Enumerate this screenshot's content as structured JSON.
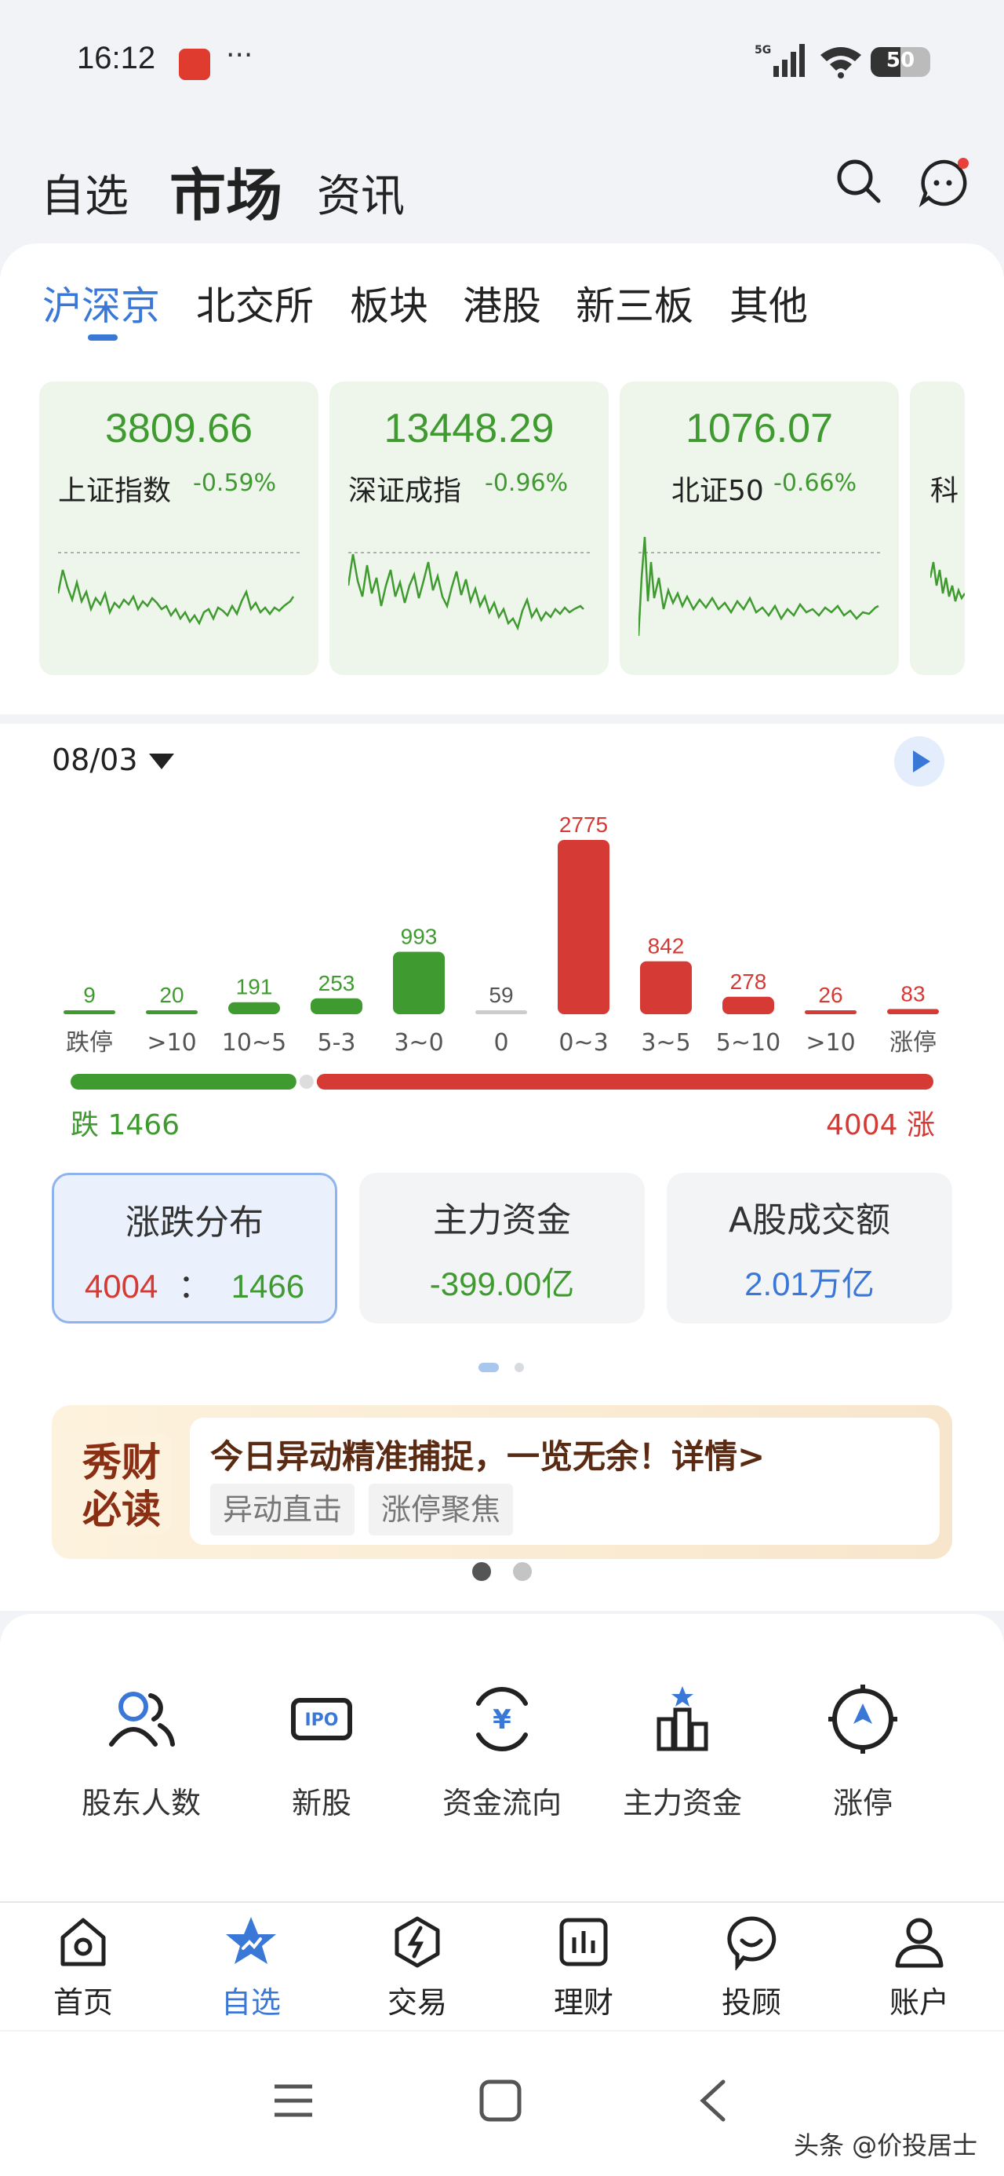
{
  "status_bar": {
    "time": "16:12",
    "dots": "···",
    "network": "5G",
    "battery": "50"
  },
  "top_nav": {
    "tabs": [
      "自选",
      "市场",
      "资讯"
    ],
    "active": "市场"
  },
  "sub_tabs": [
    "沪深京",
    "北交所",
    "板块",
    "港股",
    "新三板",
    "其他"
  ],
  "indices": [
    {
      "value": "3809.66",
      "name": "上证指数",
      "change": "-0.59%"
    },
    {
      "value": "13448.29",
      "name": "深证成指",
      "change": "-0.96%"
    },
    {
      "value": "1076.07",
      "name": "北证50",
      "change": "-0.66%"
    },
    {
      "value": "",
      "name": "科",
      "change": ""
    }
  ],
  "distribution": {
    "date": "08/03",
    "total_down_label": "跌 1466",
    "total_up_label": "4004 涨",
    "down_total": 1466,
    "up_total": 4004
  },
  "chart_data": {
    "type": "bar",
    "categories": [
      "跌停",
      ">10",
      "10~5",
      "5-3",
      "3~0",
      "0",
      "0~3",
      "3~5",
      "5~10",
      ">10",
      "涨停"
    ],
    "values": [
      9,
      20,
      191,
      253,
      993,
      59,
      2775,
      842,
      278,
      26,
      83
    ],
    "colors": [
      "#3f9a2f",
      "#3f9a2f",
      "#3f9a2f",
      "#3f9a2f",
      "#3f9a2f",
      "#cccccc",
      "#d63a34",
      "#d63a34",
      "#d63a34",
      "#d63a34",
      "#d63a34"
    ]
  },
  "stats": [
    {
      "title": "涨跌分布",
      "value_up": "4004",
      "sep": "：",
      "value_down": "1466"
    },
    {
      "title": "主力资金",
      "value": "-399.00亿"
    },
    {
      "title": "A股成交额",
      "value": "2.01万亿"
    }
  ],
  "banner": {
    "logo_text": "秀财必读",
    "title": "今日异动精准捕捉，一览无余！详情>",
    "chips": [
      "异动直击",
      "涨停聚焦"
    ]
  },
  "shortcuts": [
    "股东人数",
    "新股",
    "资金流向",
    "主力资金",
    "涨停"
  ],
  "bottom_nav": [
    "首页",
    "自选",
    "交易",
    "理财",
    "投顾",
    "账户"
  ],
  "watermark": "头条 @价投居士",
  "colors": {
    "up": "#d63a34",
    "down": "#3f9a2f",
    "accent": "#3a78d8"
  }
}
